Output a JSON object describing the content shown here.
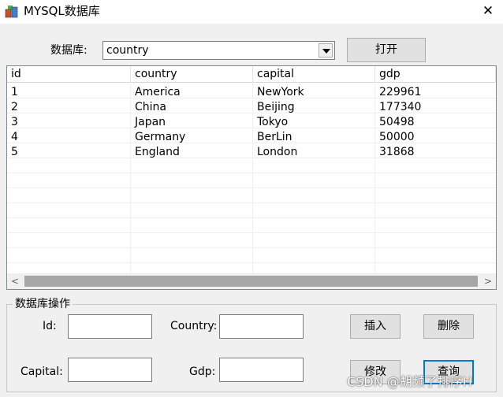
{
  "window": {
    "title": "MYSQL数据库",
    "close_label": "✕"
  },
  "top": {
    "db_label": "数据库:",
    "db_selected": "country",
    "open_button": "打开"
  },
  "table": {
    "columns": [
      "id",
      "country",
      "capital",
      "gdp"
    ],
    "rows": [
      [
        "1",
        "America",
        "NewYork",
        "229961"
      ],
      [
        "2",
        "China",
        "Beijing",
        "177340"
      ],
      [
        "3",
        "Japan",
        "Tokyo",
        "50498"
      ],
      [
        "4",
        "Germany",
        "BerLin",
        "50000"
      ],
      [
        "5",
        "England",
        "London",
        "31868"
      ]
    ],
    "scroll_left": "<",
    "scroll_right": ">"
  },
  "ops": {
    "group_title": "数据库操作",
    "id_label": "Id:",
    "country_label": "Country:",
    "capital_label": "Capital:",
    "gdp_label": "Gdp:",
    "id_value": "",
    "country_value": "",
    "capital_value": "",
    "gdp_value": "",
    "insert_button": "插入",
    "delete_button": "删除",
    "update_button": "修改",
    "query_button": "查询"
  },
  "watermark": "CSDN @胡频了排序H"
}
